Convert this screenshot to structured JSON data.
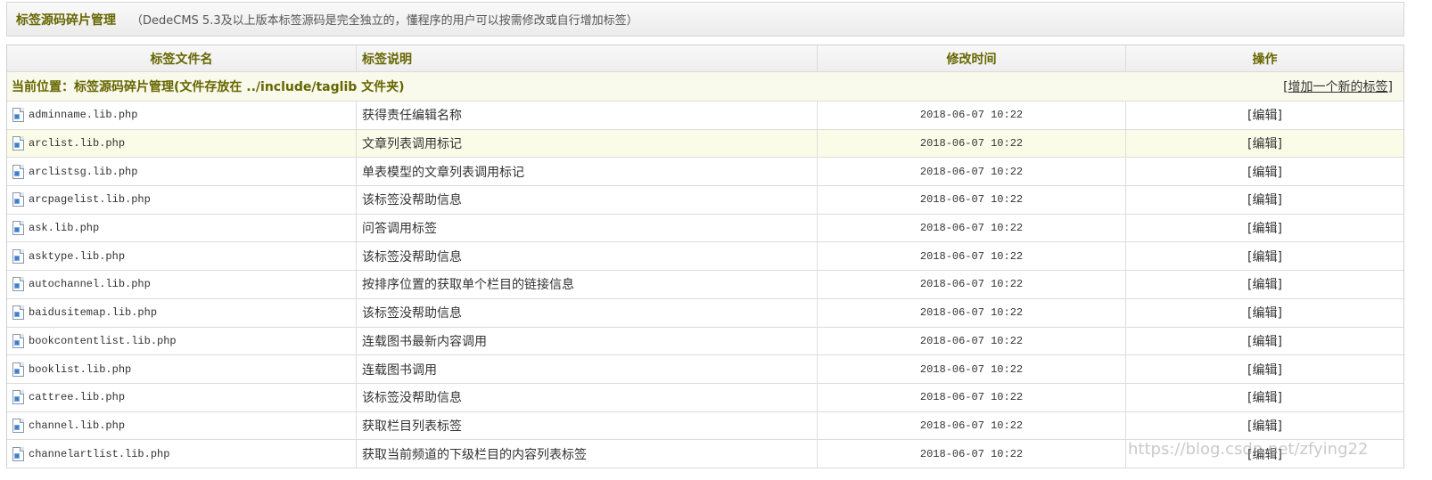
{
  "header": {
    "title": "标签源码碎片管理",
    "subtitle": "（DedeCMS 5.3及以上版本标签源码是完全独立的，懂程序的用户可以按需修改或自行增加标签）"
  },
  "table": {
    "columns": [
      "标签文件名",
      "标签说明",
      "修改时间",
      "操作"
    ],
    "location_text": "当前位置：标签源码碎片管理(文件存放在 ../include/taglib 文件夹)",
    "add_link": {
      "prefix": "[",
      "label": "增加一个新的标签",
      "suffix": "]"
    },
    "row_icon": "file-icon",
    "rows": [
      {
        "file": "adminname.lib.php",
        "desc": "获得责任编辑名称",
        "time": "2018-06-07 10:22",
        "action": "[编辑]"
      },
      {
        "file": "arclist.lib.php",
        "desc": "文章列表调用标记",
        "time": "2018-06-07 10:22",
        "action": "[编辑]",
        "highlighted": true
      },
      {
        "file": "arclistsg.lib.php",
        "desc": "单表模型的文章列表调用标记",
        "time": "2018-06-07 10:22",
        "action": "[编辑]"
      },
      {
        "file": "arcpagelist.lib.php",
        "desc": "该标签没帮助信息",
        "time": "2018-06-07 10:22",
        "action": "[编辑]"
      },
      {
        "file": "ask.lib.php",
        "desc": "问答调用标签",
        "time": "2018-06-07 10:22",
        "action": "[编辑]"
      },
      {
        "file": "asktype.lib.php",
        "desc": "该标签没帮助信息",
        "time": "2018-06-07 10:22",
        "action": "[编辑]"
      },
      {
        "file": "autochannel.lib.php",
        "desc": "按排序位置的获取单个栏目的链接信息",
        "time": "2018-06-07 10:22",
        "action": "[编辑]"
      },
      {
        "file": "baidusitemap.lib.php",
        "desc": "该标签没帮助信息",
        "time": "2018-06-07 10:22",
        "action": "[编辑]"
      },
      {
        "file": "bookcontentlist.lib.php",
        "desc": "连载图书最新内容调用",
        "time": "2018-06-07 10:22",
        "action": "[编辑]"
      },
      {
        "file": "booklist.lib.php",
        "desc": "连载图书调用",
        "time": "2018-06-07 10:22",
        "action": "[编辑]"
      },
      {
        "file": "cattree.lib.php",
        "desc": "该标签没帮助信息",
        "time": "2018-06-07 10:22",
        "action": "[编辑]"
      },
      {
        "file": "channel.lib.php",
        "desc": "获取栏目列表标签",
        "time": "2018-06-07 10:22",
        "action": "[编辑]"
      },
      {
        "file": "channelartlist.lib.php",
        "desc": "获取当前频道的下级栏目的内容列表标签",
        "time": "2018-06-07 10:22",
        "action": "[编辑]"
      }
    ]
  },
  "watermark": "https://blog.csdn.net/zfying22",
  "colors": {
    "accent_text": "#666600",
    "location_row_bg": "#f9f9ec",
    "highlight_row_bg": "#fbfce8",
    "border": "#dcdcdc"
  }
}
